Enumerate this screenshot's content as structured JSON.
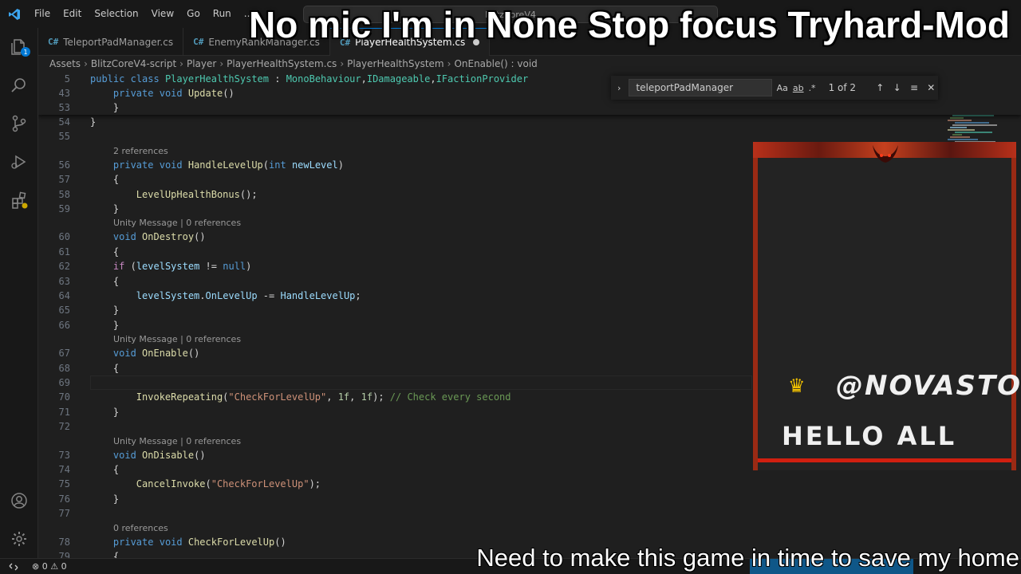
{
  "stream": {
    "title": "No mic I'm in None Stop focus Tryhard-Mod",
    "caption": "Need to make this game in time to save my home",
    "overlay_handle": "@NOVASTO",
    "overlay_greeting": "HELLO ALL"
  },
  "titlebar": {
    "menu": [
      "File",
      "Edit",
      "Selection",
      "View",
      "Go",
      "Run",
      "..."
    ],
    "command_center": "BlitzCoreV4"
  },
  "activity_bar": {
    "icons": [
      "files-icon",
      "search-icon",
      "source-control-icon",
      "run-debug-icon",
      "extensions-icon"
    ],
    "explorer_badge": "1",
    "bottom_icons": [
      "account-icon",
      "settings-gear-icon"
    ]
  },
  "tabs": [
    {
      "label": "TeleportPadManager.cs",
      "active": false
    },
    {
      "label": "EnemyRankManager.cs",
      "active": false
    },
    {
      "label": "PlayerHealthSystem.cs",
      "active": true,
      "dirty": true
    }
  ],
  "breadcrumb": [
    "Assets",
    "BlitzCoreV4-script",
    "Player",
    "PlayerHealthSystem.cs",
    "PlayerHealthSystem",
    "OnEnable() : void"
  ],
  "find": {
    "query": "teleportPadManager",
    "match_case": "Aa",
    "whole_word": "ab",
    "regex": ".*",
    "result": "1 of 2"
  },
  "sticky_lines": [
    {
      "num": "5",
      "text": "public class PlayerHealthSystem : MonoBehaviour,IDamageable,IFactionProvider"
    },
    {
      "num": "43",
      "text": "    private void Update()"
    },
    {
      "num": "53",
      "text": "    }"
    }
  ],
  "code_lines": [
    {
      "num": "54",
      "text": "}"
    },
    {
      "num": "55",
      "text": ""
    },
    {
      "lens": "2 references"
    },
    {
      "num": "56",
      "text": "    private void HandleLevelUp(int newLevel)"
    },
    {
      "num": "57",
      "text": "    {"
    },
    {
      "num": "58",
      "text": "        LevelUpHealthBonus();"
    },
    {
      "num": "59",
      "text": "    }"
    },
    {
      "lens": "Unity Message | 0 references"
    },
    {
      "num": "60",
      "text": "    void OnDestroy()"
    },
    {
      "num": "61",
      "text": "    {"
    },
    {
      "num": "62",
      "text": "    if (levelSystem != null)"
    },
    {
      "num": "63",
      "text": "    {"
    },
    {
      "num": "64",
      "text": "        levelSystem.OnLevelUp -= HandleLevelUp;"
    },
    {
      "num": "65",
      "text": "    }"
    },
    {
      "num": "66",
      "text": "    }"
    },
    {
      "lens": "Unity Message | 0 references"
    },
    {
      "num": "67",
      "text": "    void OnEnable()"
    },
    {
      "num": "68",
      "text": "    {"
    },
    {
      "num": "69",
      "text": ""
    },
    {
      "num": "70",
      "text": "        InvokeRepeating(\"CheckForLevelUp\", 1f, 1f); // Check every second"
    },
    {
      "num": "71",
      "text": "    }"
    },
    {
      "num": "72",
      "text": ""
    },
    {
      "lens": "Unity Message | 0 references"
    },
    {
      "num": "73",
      "text": "    void OnDisable()"
    },
    {
      "num": "74",
      "text": "    {"
    },
    {
      "num": "75",
      "text": "        CancelInvoke(\"CheckForLevelUp\");"
    },
    {
      "num": "76",
      "text": "    }"
    },
    {
      "num": "77",
      "text": ""
    },
    {
      "lens": "0 references"
    },
    {
      "num": "78",
      "text": "    private void CheckForLevelUp()"
    },
    {
      "num": "79",
      "text": "    {"
    }
  ],
  "statusbar": {
    "problems": "⊗ 0 ⚠ 0"
  },
  "colors": {
    "keyword": "#569cd6",
    "control": "#c586c0",
    "type": "#4ec9b0",
    "function": "#dcdcaa",
    "variable": "#9cdcfe",
    "string": "#ce9178",
    "number": "#b5cea8",
    "comment": "#6a9955",
    "accent": "#0078d4"
  }
}
